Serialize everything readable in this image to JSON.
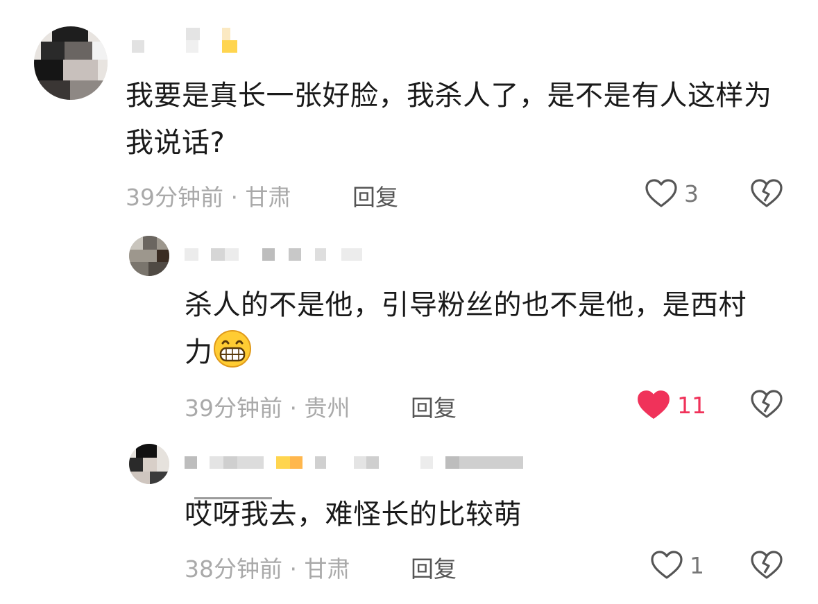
{
  "comments": [
    {
      "text": "我要是真长一张好脸，我杀人了，是不是有人这样为我说话?",
      "time": "39分钟前",
      "location": "甘肃",
      "reply_label": "回复",
      "likes": "3",
      "liked": false
    },
    {
      "text": "杀人的不是他，引导粉丝的也不是他，是西村力",
      "emoji": "grinning-face-emoji",
      "time": "39分钟前",
      "location": "贵州",
      "reply_label": "回复",
      "likes": "11",
      "liked": true
    },
    {
      "text": "哎呀我去，难怪长的比较萌",
      "time": "38分钟前",
      "location": "甘肃",
      "reply_label": "回复",
      "likes": "1",
      "liked": false
    }
  ],
  "meta_separator": " · ",
  "colors": {
    "liked": "#f0325a",
    "muted": "#a9a9a9",
    "text": "#1a1a1a"
  }
}
